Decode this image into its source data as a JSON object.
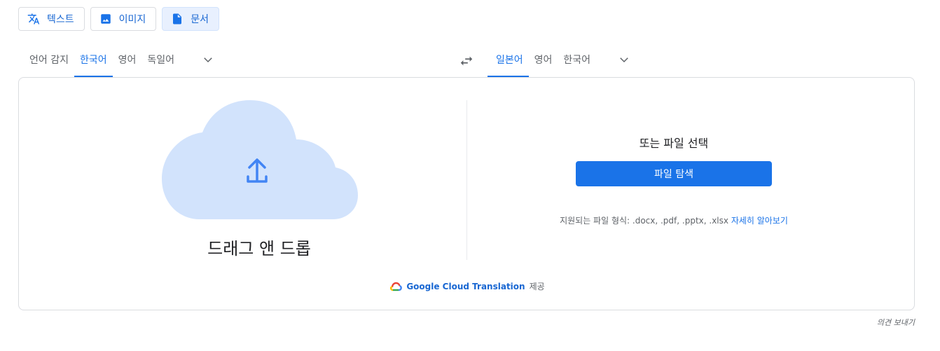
{
  "mode_tabs": [
    {
      "label": "텍스트",
      "icon": "translate-icon"
    },
    {
      "label": "이미지",
      "icon": "image-icon"
    },
    {
      "label": "문서",
      "icon": "document-icon"
    }
  ],
  "source_langs": [
    "언어 감지",
    "한국어",
    "영어",
    "독일어"
  ],
  "target_langs": [
    "일본어",
    "영어",
    "한국어"
  ],
  "dropzone": {
    "label": "드래그 앤 드롭",
    "icon": "cloud-upload-icon"
  },
  "file_select": {
    "or_label": "또는 파일 선택",
    "browse_label": "파일 탐색",
    "supported_text": "지원되는 파일 형식: .docx, .pdf, .pptx, .xlsx",
    "learn_more": "자세히 알아보기"
  },
  "powered_by": {
    "brand": "Google Cloud Translation",
    "suffix": "제공"
  },
  "feedback_label": "의견 보내기",
  "colors": {
    "accent": "#1a73e8",
    "cloud": "#d2e3fc",
    "border": "#dadce0"
  }
}
